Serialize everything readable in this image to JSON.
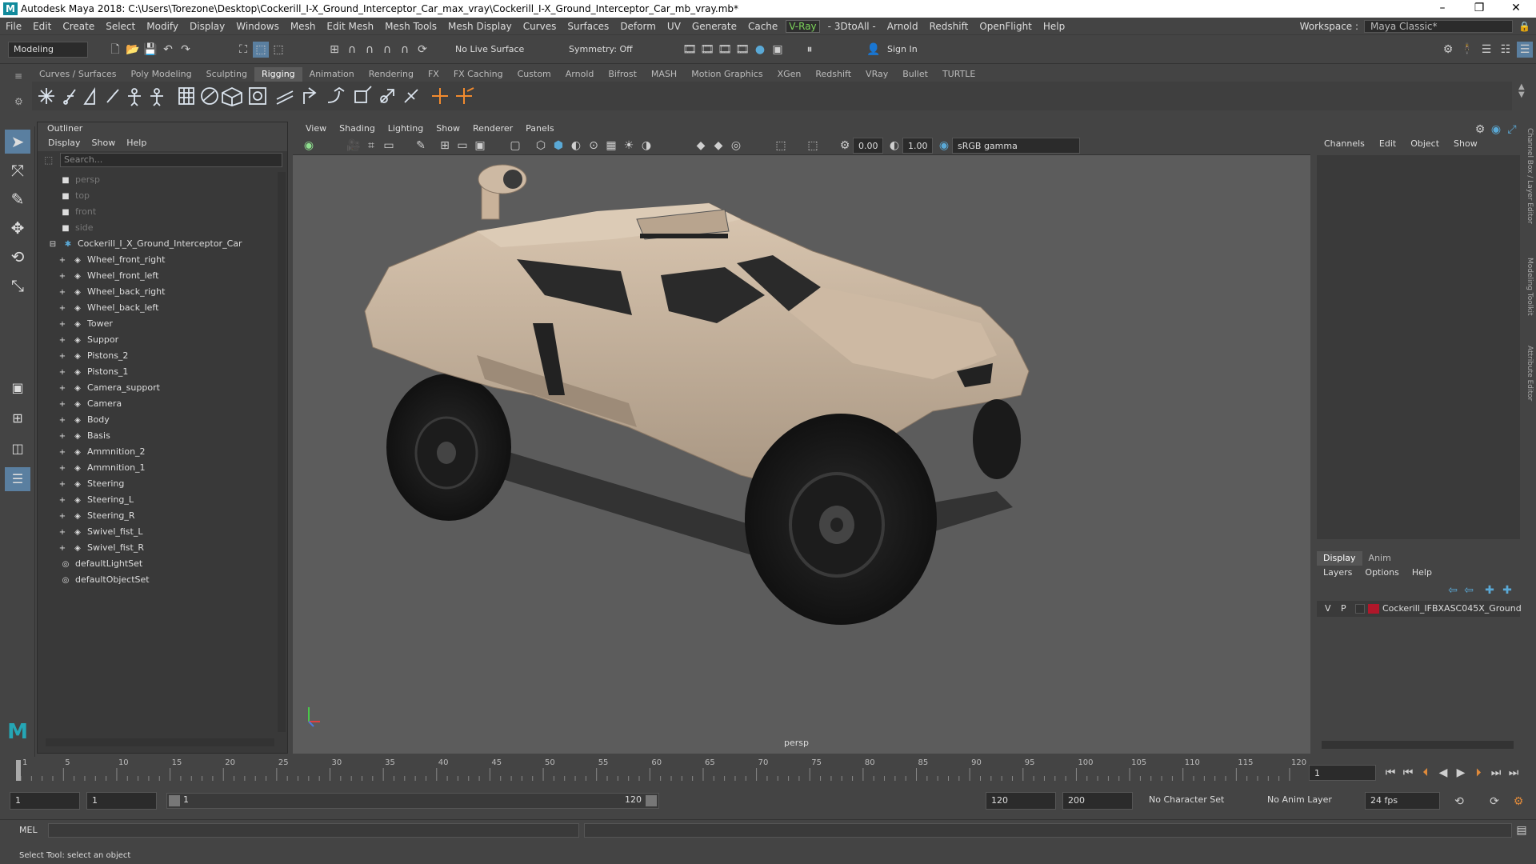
{
  "app": {
    "title": "Autodesk Maya 2018: C:\\Users\\Torezone\\Desktop\\Cockerill_I-X_Ground_Interceptor_Car_max_vray\\Cockerill_I-X_Ground_Interceptor_Car_mb_vray.mb*",
    "logo_letter": "M"
  },
  "menu": [
    "File",
    "Edit",
    "Create",
    "Select",
    "Modify",
    "Display",
    "Windows",
    "Mesh",
    "Edit Mesh",
    "Mesh Tools",
    "Mesh Display",
    "Curves",
    "Surfaces",
    "Deform",
    "UV",
    "Generate",
    "Cache",
    "V-Ray",
    "- 3DtoAll -",
    "Arnold",
    "Redshift",
    "OpenFlight",
    "Help"
  ],
  "workspace": {
    "label": "Workspace :",
    "value": "Maya Classic*"
  },
  "status": {
    "mode": "Modeling",
    "live_surface": "No Live Surface",
    "symmetry": "Symmetry: Off",
    "sign_in": "Sign In"
  },
  "shelf_tabs": [
    "Curves / Surfaces",
    "Poly Modeling",
    "Sculpting",
    "Rigging",
    "Animation",
    "Rendering",
    "FX",
    "FX Caching",
    "Custom",
    "Arnold",
    "Bifrost",
    "MASH",
    "Motion Graphics",
    "XGen",
    "Redshift",
    "VRay",
    "Bullet",
    "TURTLE"
  ],
  "shelf_active": "Rigging",
  "outliner": {
    "title": "Outliner",
    "menu": [
      "Display",
      "Show",
      "Help"
    ],
    "search_placeholder": "Search...",
    "cameras": [
      "persp",
      "top",
      "front",
      "side"
    ],
    "group": "Cockerill_I_X_Ground_Interceptor_Car",
    "children": [
      "Wheel_front_right",
      "Wheel_front_left",
      "Wheel_back_right",
      "Wheel_back_left",
      "Tower",
      "Suppor",
      "Pistons_2",
      "Pistons_1",
      "Camera_support",
      "Camera",
      "Body",
      "Basis",
      "Ammnition_2",
      "Ammnition_1",
      "Steering",
      "Steering_L",
      "Steering_R",
      "Swivel_fist_L",
      "Swivel_fist_R"
    ],
    "sets": [
      "defaultLightSet",
      "defaultObjectSet"
    ]
  },
  "viewport": {
    "menu": [
      "View",
      "Shading",
      "Lighting",
      "Show",
      "Renderer",
      "Panels"
    ],
    "field_a": "0.00",
    "field_b": "1.00",
    "color_space": "sRGB gamma",
    "camera_label": "persp"
  },
  "channelbox": {
    "menu": [
      "Channels",
      "Edit",
      "Object",
      "Show"
    ],
    "layer_tabs": [
      "Display",
      "Anim"
    ],
    "layer_menu": [
      "Layers",
      "Options",
      "Help"
    ],
    "layer_v": "V",
    "layer_p": "P",
    "layer_color": "#b0172a",
    "layer_name": "Cockerill_IFBXASC045X_Ground"
  },
  "side_labels": [
    "Channel Box / Layer Editor",
    "Modeling Toolkit",
    "Attribute Editor"
  ],
  "timeline": {
    "ticks": [
      "1",
      "5",
      "10",
      "15",
      "20",
      "25",
      "30",
      "35",
      "40",
      "45",
      "50",
      "55",
      "60",
      "65",
      "70",
      "75",
      "80",
      "85",
      "90",
      "95",
      "100",
      "105",
      "110",
      "115",
      "120"
    ],
    "current_frame": "1"
  },
  "range": {
    "start": "1",
    "playback_start": "1",
    "slider_start": "1",
    "slider_end": "120",
    "playback_end": "120",
    "end": "200",
    "character_set": "No Character Set",
    "anim_layer": "No Anim Layer",
    "fps": "24 fps"
  },
  "cmd": {
    "label": "MEL"
  },
  "help_text": "Select Tool: select an object",
  "colors": {
    "body_tan": "#c9b29a",
    "tire": "#1e1e1e",
    "accent": "#5aa9d6"
  }
}
